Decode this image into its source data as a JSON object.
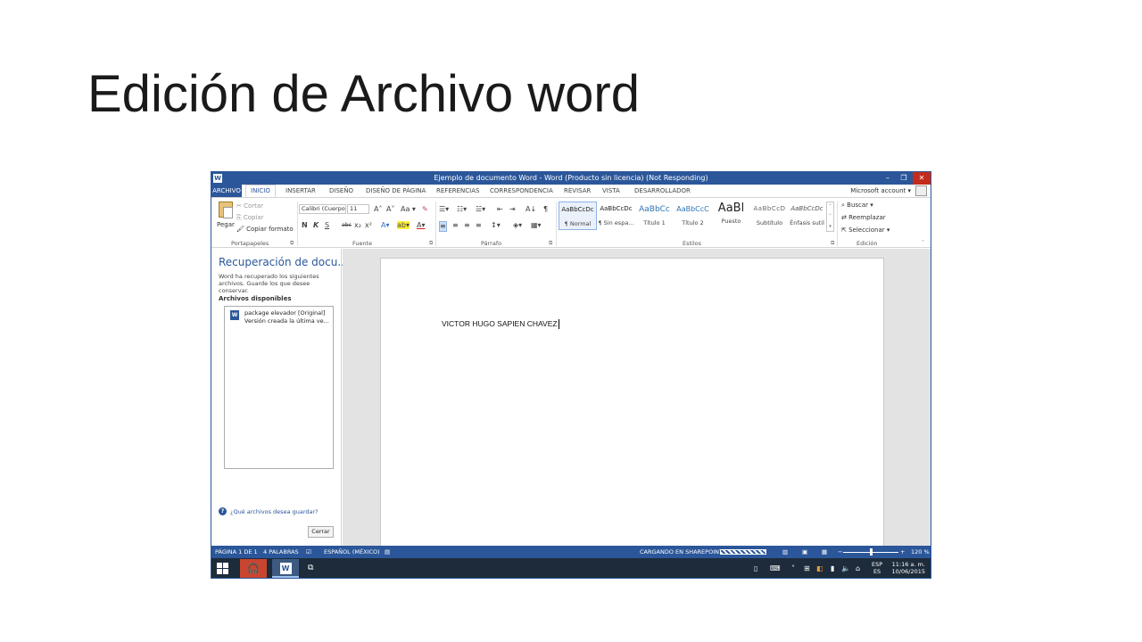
{
  "slide": {
    "title": "Edición de Archivo word"
  },
  "window": {
    "title": "Ejemplo de documento Word - Word (Producto sin licencia) (Not Responding)",
    "app_icon": "W",
    "controls": {
      "minimize": "–",
      "restore": "❐",
      "close": "✕"
    }
  },
  "tabs": {
    "file": "ARCHIVO",
    "items": [
      "INICIO",
      "INSERTAR",
      "DISEÑO",
      "DISEÑO DE PÁGINA",
      "REFERENCIAS",
      "CORRESPONDENCIA",
      "REVISAR",
      "VISTA",
      "DESARROLLADOR"
    ],
    "account": "Microsoft account ▾"
  },
  "ribbon": {
    "clipboard": {
      "paste": "Pegar",
      "cut": "Cortar",
      "copy": "Copiar",
      "format_painter": "Copiar formato",
      "label": "Portapapeles"
    },
    "font": {
      "font_name": "Calibri (Cuerpo",
      "font_size": "11",
      "bold": "N",
      "italic": "K",
      "underline": "S",
      "strike": "abc",
      "sub": "x₂",
      "sup": "x²",
      "grow": "A˄",
      "shrink": "A˅",
      "case": "Aa ▾",
      "label": "Fuente"
    },
    "paragraph": {
      "label": "Párrafo",
      "pilcrow": "¶",
      "sort": "A↓"
    },
    "styles": {
      "label": "Estilos",
      "items": [
        {
          "sample": "AaBbCcDc",
          "name": "¶ Normal"
        },
        {
          "sample": "AaBbCcDc",
          "name": "¶ Sin espa..."
        },
        {
          "sample": "AaBbCc",
          "name": "Título 1"
        },
        {
          "sample": "AaBbCcC",
          "name": "Título 2"
        },
        {
          "sample": "AaBl",
          "name": "Puesto"
        },
        {
          "sample": "AaBbCcD",
          "name": "Subtítulo"
        },
        {
          "sample": "AaBbCcDc",
          "name": "Énfasis sutil"
        }
      ]
    },
    "editing": {
      "find": "Buscar ▾",
      "replace": "Reemplazar",
      "select": "Seleccionar ▾",
      "label": "Edición"
    }
  },
  "recovery": {
    "title": "Recuperación de docu...",
    "description": "Word ha recuperado los siguientes archivos. Guarde los que desee conservar.",
    "subtitle": "Archivos disponibles",
    "file_name": "package elevador  [Original]",
    "file_version": "Versión creada la última ve...",
    "help_link": "¿Qué archivos desea guardar?",
    "close_button": "Cerrar"
  },
  "document": {
    "text": "VICTOR HUGO SAPIEN CHAVEZ"
  },
  "status": {
    "page": "PÁGINA 1 DE 1",
    "words": "4 PALABRAS",
    "language": "ESPAÑOL (MÉXICO)",
    "loading": "CARGANDO EN SHAREPOINT",
    "zoom": "120 %"
  },
  "taskbar": {
    "lang_top": "ESP",
    "lang_bottom": "ES",
    "time": "11:16 a. m.",
    "date": "10/06/2015"
  },
  "colors": {
    "word_blue": "#2b579a",
    "taskbar": "#1d2b3a"
  }
}
